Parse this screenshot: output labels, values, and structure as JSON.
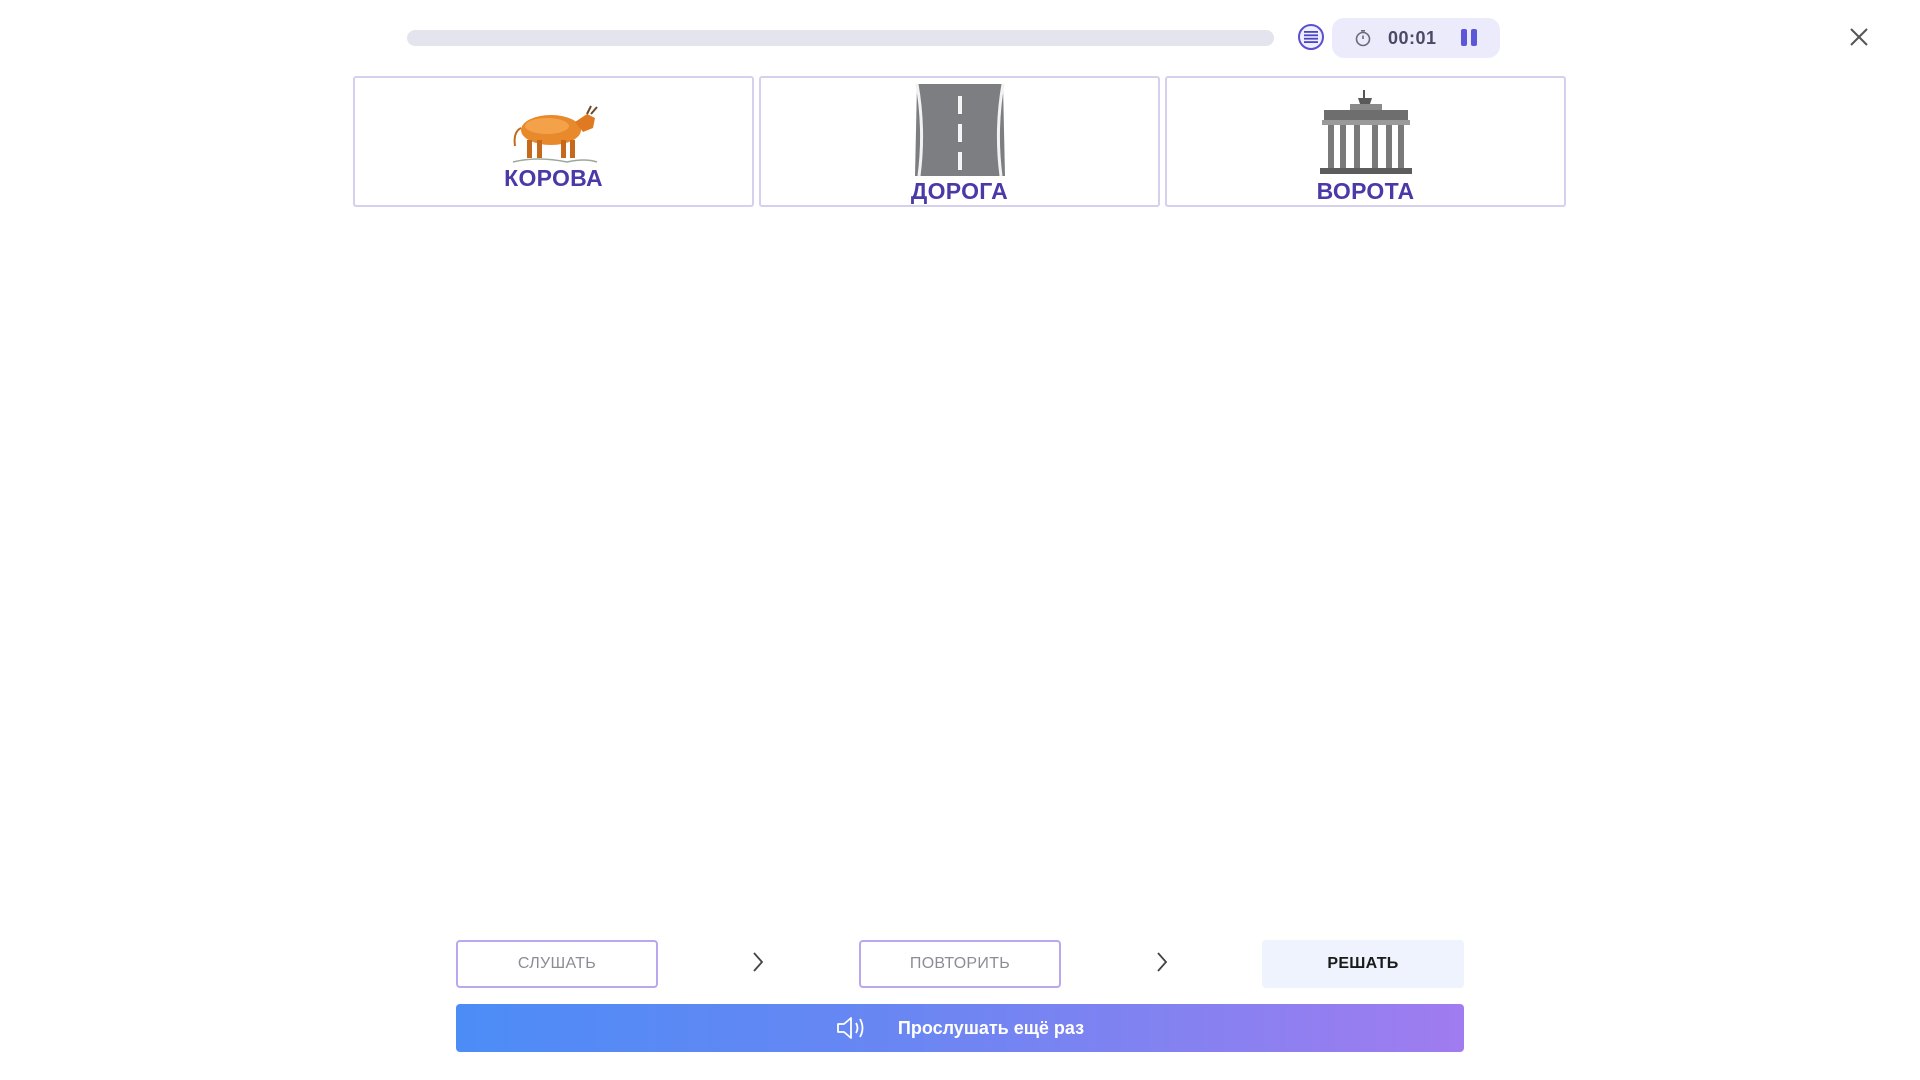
{
  "progress": {
    "value": 0
  },
  "timer": {
    "time": "00:01"
  },
  "cards": [
    {
      "label": "КОРОВА",
      "image": "cow-image"
    },
    {
      "label": "ДОРОГА",
      "image": "road-image"
    },
    {
      "label": "ВОРОТА",
      "image": "gate-image"
    }
  ],
  "steps": {
    "listen": "СЛУШАТЬ",
    "repeat": "ПОВТОРИТЬ",
    "solve": "РЕШАТЬ"
  },
  "replay_button": {
    "label": "Прослушать ещё раз"
  },
  "colors": {
    "accent": "#5b57d6",
    "label": "#4a3aa8",
    "gradient_start": "#4c8cf7",
    "gradient_end": "#a07cf0"
  },
  "icons": [
    "list-icon",
    "stopwatch-icon",
    "pause-icon",
    "close-icon",
    "chevron-right-icon",
    "speaker-icon"
  ]
}
